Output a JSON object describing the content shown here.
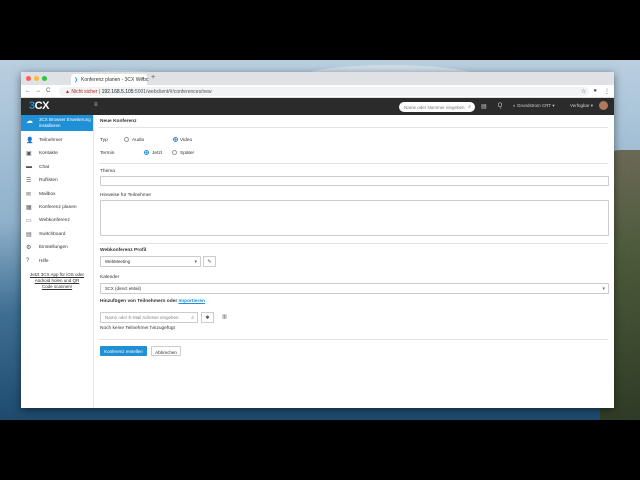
{
  "browser": {
    "tab_title": "Konferenz planen - 3CX Webc",
    "tab_close": "×",
    "new_tab": "+",
    "url_warning": "Nicht sicher",
    "url_host": "192.168.5.105",
    "url_path": ":5001/webclient/#/conferences/new",
    "nav_back": "←",
    "nav_forward": "→",
    "nav_reload": "C",
    "star_icon": "☆",
    "account_icon": "●",
    "menu_icon": "⋮"
  },
  "header": {
    "logo_main": "3",
    "logo_accent": "CX",
    "menu_icon": "≡",
    "search_placeholder": "Name oder Nummer eingeben",
    "search_icon": "⌕",
    "chat_icon": "▤",
    "q_icon": "Q",
    "user_name": "Grundstrom CRT",
    "status": "Verfügbar"
  },
  "sidebar": {
    "banner": "3CX Browser Erweiterung installieren",
    "items": [
      {
        "label": "Teilnehmer",
        "icon": "user-icon",
        "glyph": "👤"
      },
      {
        "label": "Kontakte",
        "icon": "contacts-icon",
        "glyph": "▣"
      },
      {
        "label": "Chat",
        "icon": "chat-icon",
        "glyph": "▬"
      },
      {
        "label": "Ruflisten",
        "icon": "call-log-icon",
        "glyph": "☰"
      },
      {
        "label": "Mailbox",
        "icon": "mailbox-icon",
        "glyph": "✉"
      },
      {
        "label": "Konferenz planen",
        "icon": "calendar-icon",
        "glyph": "▦"
      },
      {
        "label": "Webkonferenz",
        "icon": "webconference-icon",
        "glyph": "▭"
      },
      {
        "label": "Switchboard",
        "icon": "switchboard-icon",
        "glyph": "▤"
      },
      {
        "label": "Einstellungen",
        "icon": "settings-icon",
        "glyph": "⚙"
      },
      {
        "label": "Hilfe",
        "icon": "help-icon",
        "glyph": "?"
      }
    ],
    "promo": "Jetzt 3CX App für iOS oder Android holen und QR Code scannen!"
  },
  "form": {
    "section_title": "Neue Konferenz",
    "typ_label": "Typ",
    "typ_options": [
      "Audio",
      "Video"
    ],
    "termin_label": "Termin",
    "termin_options": [
      "Jetzt",
      "Später"
    ],
    "thema_label": "Thema",
    "hinweise_label": "Hinweise für Teilnehmer",
    "profil_label": "Webkonferenz Profil",
    "profil_value": "WebMeeting",
    "kalender_label": "Kalender",
    "kalender_value": "3CX (direct eMail)",
    "add_label": "Hinzufügen von Teilnehmern oder",
    "import_link": "Importieren",
    "participant_placeholder": "Name oder E-Mail Adresse eingeben",
    "no_participants": "Noch keine Teilnehmer hinzugefügt",
    "create_button": "Konferenz erstellen",
    "cancel_button": "Abbrechen"
  },
  "colors": {
    "accent": "#1f8fd6",
    "header": "#2b2b2b",
    "warning": "#c5221f"
  }
}
